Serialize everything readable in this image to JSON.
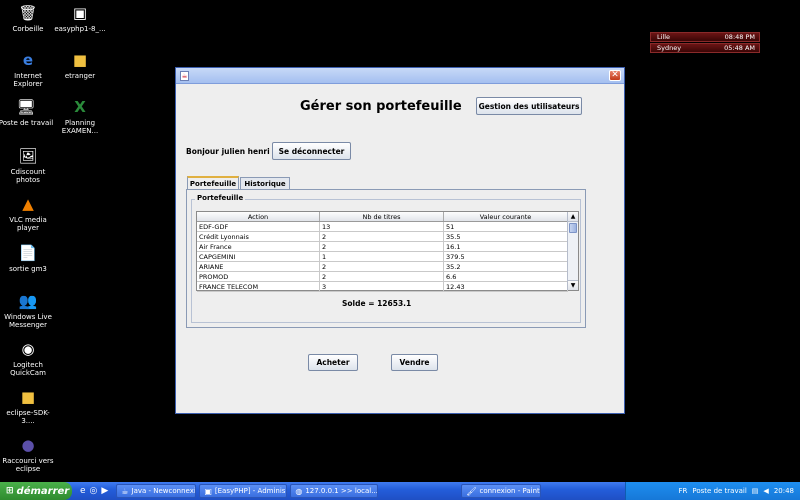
{
  "desktop_icons": [
    {
      "label": "Corbeille",
      "icon": "trash-icon"
    },
    {
      "label": "easyphp1-8_...",
      "icon": "installer-icon"
    },
    {
      "label": "Internet\nExplorer",
      "icon": "ie-icon"
    },
    {
      "label": "etranger",
      "icon": "folder-icon"
    },
    {
      "label": "Poste de travail",
      "icon": "computer-icon"
    },
    {
      "label": "Planning\nEXAMEN...",
      "icon": "excel-icon"
    },
    {
      "label": "Cdiscount\nphotos",
      "icon": "photo-icon"
    },
    {
      "label": "VLC media\nplayer",
      "icon": "vlc-icon"
    },
    {
      "label": "sortie gm3",
      "icon": "file-icon"
    },
    {
      "label": "Windows Live\nMessenger",
      "icon": "messenger-icon"
    },
    {
      "label": "Logitech\nQuickCam",
      "icon": "webcam-icon"
    },
    {
      "label": "eclipse-SDK-3....",
      "icon": "folder-icon"
    },
    {
      "label": "Raccourci vers\neclipse",
      "icon": "eclipse-icon"
    }
  ],
  "clocks": [
    {
      "city": "Lille",
      "time": "08:48 PM"
    },
    {
      "city": "Sydney",
      "time": "05:48 AM"
    }
  ],
  "window": {
    "title": "Gérer son portefeuille",
    "users_button": "Gestion des utilisateurs",
    "greeting": "Bonjour julien henri",
    "logout_button": "Se déconnecter",
    "tabs": [
      {
        "label": "Portefeuille",
        "active": true
      },
      {
        "label": "Historique",
        "active": false
      }
    ],
    "group_label": "Portefeuille",
    "table": {
      "headers": [
        "Action",
        "Nb de titres",
        "Valeur courante"
      ],
      "rows": [
        [
          "EDF-GDF",
          "13",
          "51"
        ],
        [
          "Crédit Lyonnais",
          "2",
          "35.5"
        ],
        [
          "Air France",
          "2",
          "16.1"
        ],
        [
          "CAPGEMINI",
          "1",
          "379.5"
        ],
        [
          "ARIANE",
          "2",
          "35.2"
        ],
        [
          "PROMOD",
          "2",
          "6.6"
        ],
        [
          "FRANCE TELECOM",
          "3",
          "12.43"
        ]
      ]
    },
    "solde": "Solde = 12653.1",
    "buy_button": "Acheter",
    "sell_button": "Vendre"
  },
  "taskbar": {
    "start_label": "démarrer",
    "tasks": [
      {
        "label": "Java - Newconnexi...",
        "icon": "java-task-icon"
      },
      {
        "label": "[EasyPHP] - Adminis...",
        "icon": "easyphp-task-icon"
      },
      {
        "label": "127.0.0.1 >> local...",
        "icon": "browser-task-icon"
      },
      {
        "label": "connexion - Paint",
        "icon": "paint-task-icon"
      }
    ],
    "lang": "FR",
    "tray_label": "Poste de travail",
    "time": "20:48"
  }
}
